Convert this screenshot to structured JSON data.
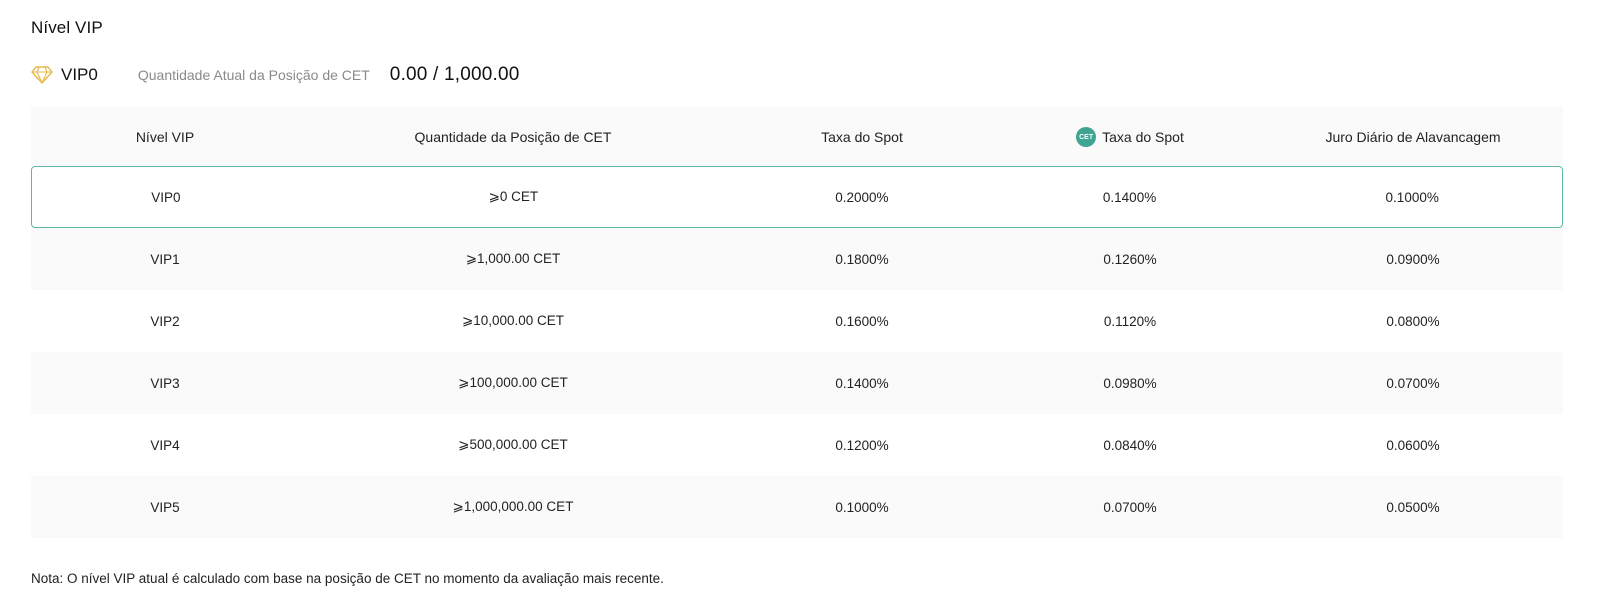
{
  "header": {
    "title": "Nível VIP"
  },
  "status": {
    "vip_level": "VIP0",
    "position_label": "Quantidade Atual da Posição de CET",
    "position_value": "0.00 / 1,000.00"
  },
  "table": {
    "headers": [
      "Nível VIP",
      "Quantidade da Posição de CET",
      "Taxa do Spot",
      "Taxa do Spot",
      "Juro Diário de Alavancagem"
    ],
    "cet_icon_text": "CET",
    "rows": [
      [
        "VIP0",
        "⩾0 CET",
        "0.2000%",
        "0.1400%",
        "0.1000%"
      ],
      [
        "VIP1",
        "⩾1,000.00 CET",
        "0.1800%",
        "0.1260%",
        "0.0900%"
      ],
      [
        "VIP2",
        "⩾10,000.00 CET",
        "0.1600%",
        "0.1120%",
        "0.0800%"
      ],
      [
        "VIP3",
        "⩾100,000.00 CET",
        "0.1400%",
        "0.0980%",
        "0.0700%"
      ],
      [
        "VIP4",
        "⩾500,000.00 CET",
        "0.1200%",
        "0.0840%",
        "0.0600%"
      ],
      [
        "VIP5",
        "⩾1,000,000.00 CET",
        "0.1000%",
        "0.0700%",
        "0.0500%"
      ]
    ]
  },
  "note": "Nota: O nível VIP atual é calculado com base na posição de CET no momento da avaliação mais recente.",
  "colors": {
    "accent": "#3fa491",
    "current_row_border": "#5fb8a5",
    "diamond": "#e6b84a"
  },
  "icons": {
    "vip": "diamond-icon",
    "cet": "cet-coin-icon"
  }
}
